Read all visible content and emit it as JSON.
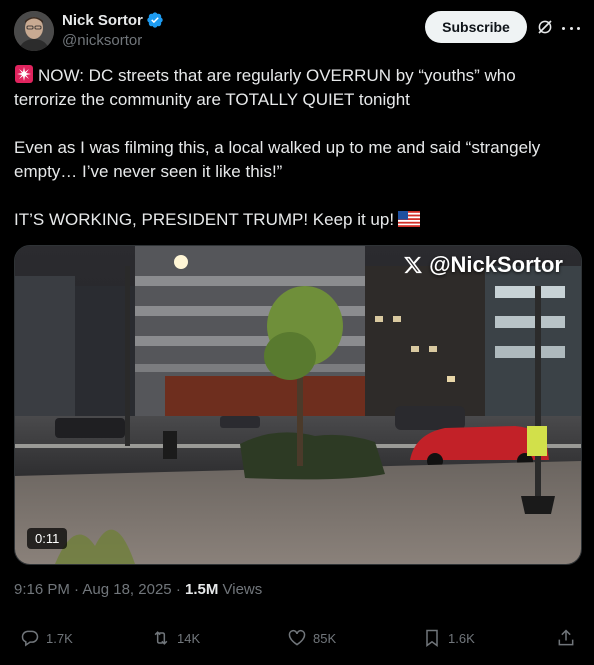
{
  "author": {
    "display_name": "Nick Sortor",
    "handle": "@nicksortor",
    "verified": true
  },
  "header": {
    "subscribe_label": "Subscribe"
  },
  "tweet": {
    "paragraphs": [
      "NOW: DC streets that are regularly OVERRUN by “youths” who terrorize the community are TOTALLY QUIET tonight",
      "Even as I was filming this, a local walked up to me and said “strangely empty… I’ve never seen it like this!”",
      "IT’S WORKING, PRESIDENT TRUMP! Keep it up!"
    ],
    "leading_emoji": "siren-emoji",
    "trailing_emoji": "us-flag-emoji"
  },
  "media": {
    "watermark": "@NickSortor",
    "duration": "0:11"
  },
  "meta": {
    "time": "9:16 PM",
    "separator": "·",
    "date": "Aug 18, 2025",
    "views_count": "1.5M",
    "views_label": "Views"
  },
  "actions": {
    "replies": "1.7K",
    "reposts": "14K",
    "likes": "85K",
    "bookmarks": "1.6K"
  },
  "colors": {
    "background": "#000000",
    "text": "#e7e9ea",
    "muted": "#71767b",
    "verified_blue": "#1d9bf0",
    "button_bg": "#eff3f4"
  }
}
